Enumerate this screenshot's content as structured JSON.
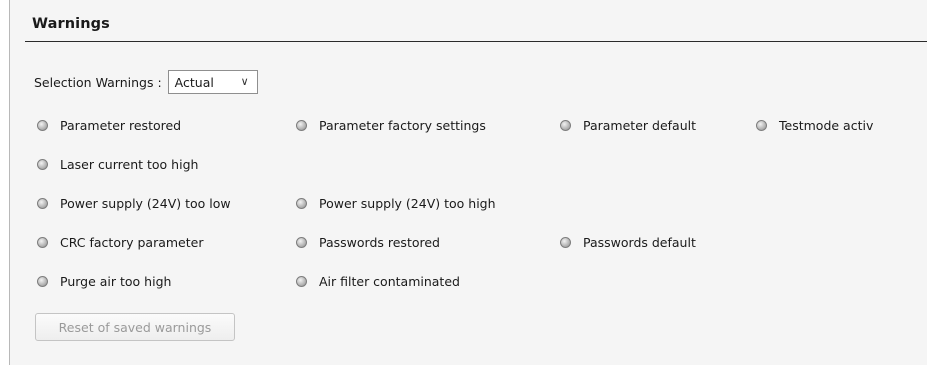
{
  "panel": {
    "title": "Warnings"
  },
  "selection": {
    "label": "Selection Warnings :",
    "value": "Actual"
  },
  "warnings": {
    "parameter_restored": "Parameter restored",
    "parameter_factory_settings": "Parameter factory settings",
    "parameter_default": "Parameter default",
    "testmode_activ": "Testmode activ",
    "laser_current_too_high": "Laser current too high",
    "power_supply_too_low": "Power supply (24V) too low",
    "power_supply_too_high": "Power supply (24V) too high",
    "crc_factory_parameter": "CRC factory parameter",
    "passwords_restored": "Passwords restored",
    "passwords_default": "Passwords default",
    "purge_air_too_high": "Purge air too high",
    "air_filter_contaminated": "Air filter contaminated"
  },
  "reset_button": {
    "label": "Reset of saved warnings"
  },
  "icons": {
    "indicator": "status-led-icon",
    "dropdown": "chevron-down-icon"
  },
  "colors": {
    "panel_background": "#f5f5f5",
    "led_inactive": "#b5b5b5",
    "disabled_text": "#9a9a9a"
  }
}
